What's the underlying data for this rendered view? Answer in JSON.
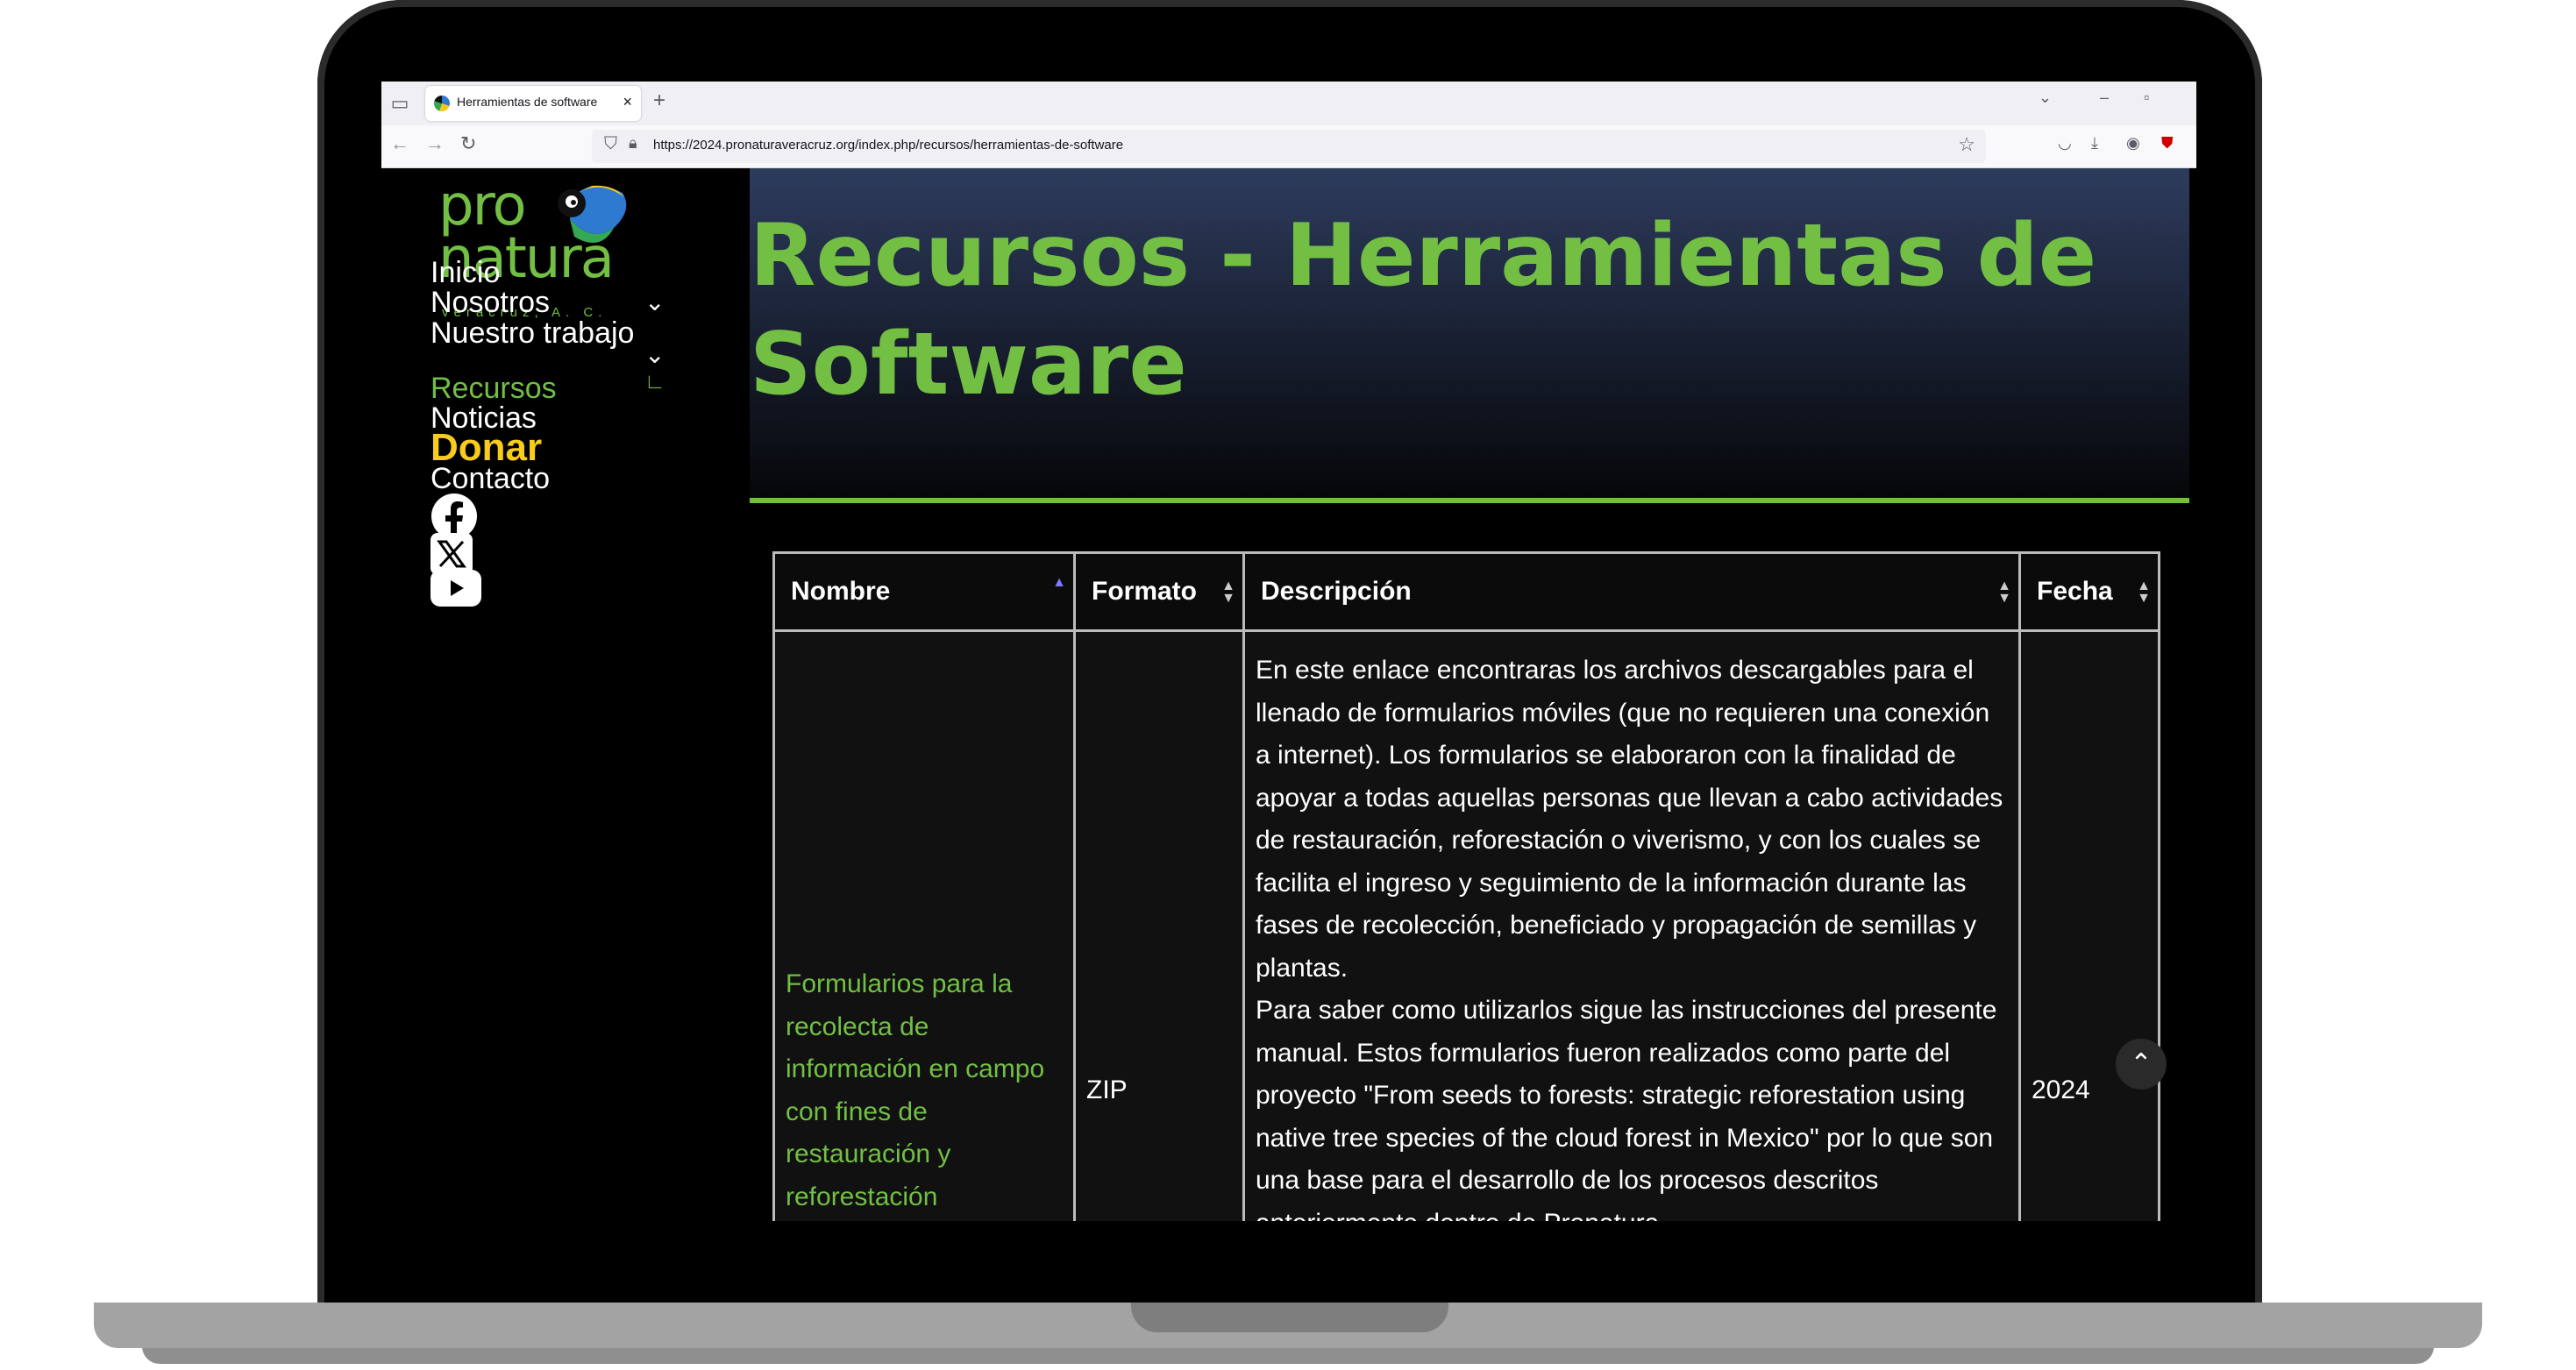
{
  "browser": {
    "tab_title": "Herramientas de software",
    "url": "https://2024.pronaturaveracruz.org/index.php/recursos/herramientas-de-software"
  },
  "logo": {
    "line1": "pro",
    "line2": "natura",
    "line3": "veracruz, A. C."
  },
  "sidebar": {
    "items": [
      {
        "label": "Inicio"
      },
      {
        "label": "Nosotros"
      },
      {
        "label": "Nuestro trabajo"
      },
      {
        "label": "Recursos"
      },
      {
        "label": "Noticias"
      },
      {
        "label": "Donar"
      },
      {
        "label": "Contacto"
      }
    ],
    "social": [
      "facebook-icon",
      "x-twitter-icon",
      "youtube-icon"
    ]
  },
  "page": {
    "title": "Recursos - Herramientas de Software"
  },
  "table": {
    "headers": [
      "Nombre",
      "Formato",
      "Descripción",
      "Fecha"
    ],
    "rows": [
      {
        "nombre": "Formularios para la recolecta de información en campo con fines de restauración y reforestación",
        "formato": "ZIP",
        "descripcion_1": "En este enlace encontraras los archivos descargables para el llenado de formularios móviles (que no requieren una conexión a internet). Los formularios se elaboraron con la finalidad de apoyar a todas aquellas personas que llevan a cabo actividades de restauración, reforestación o viverismo, y con los cuales se facilita el ingreso y seguimiento de la información durante las fases de recolección, beneficiado y propagación de semillas y plantas.",
        "descripcion_2": "Para saber como utilizarlos sigue las instrucciones del presente manual. Estos formularios fueron realizados como parte del proyecto \"From seeds to forests: strategic reforestation using native tree species of the cloud forest in Mexico\" por lo que son una base para el desarrollo de los procesos descritos anteriormente dentro de Pronatura",
        "fecha": "2024"
      }
    ]
  },
  "colors": {
    "accent_green": "#72bf44",
    "donate_yellow": "#f8cc1a"
  }
}
